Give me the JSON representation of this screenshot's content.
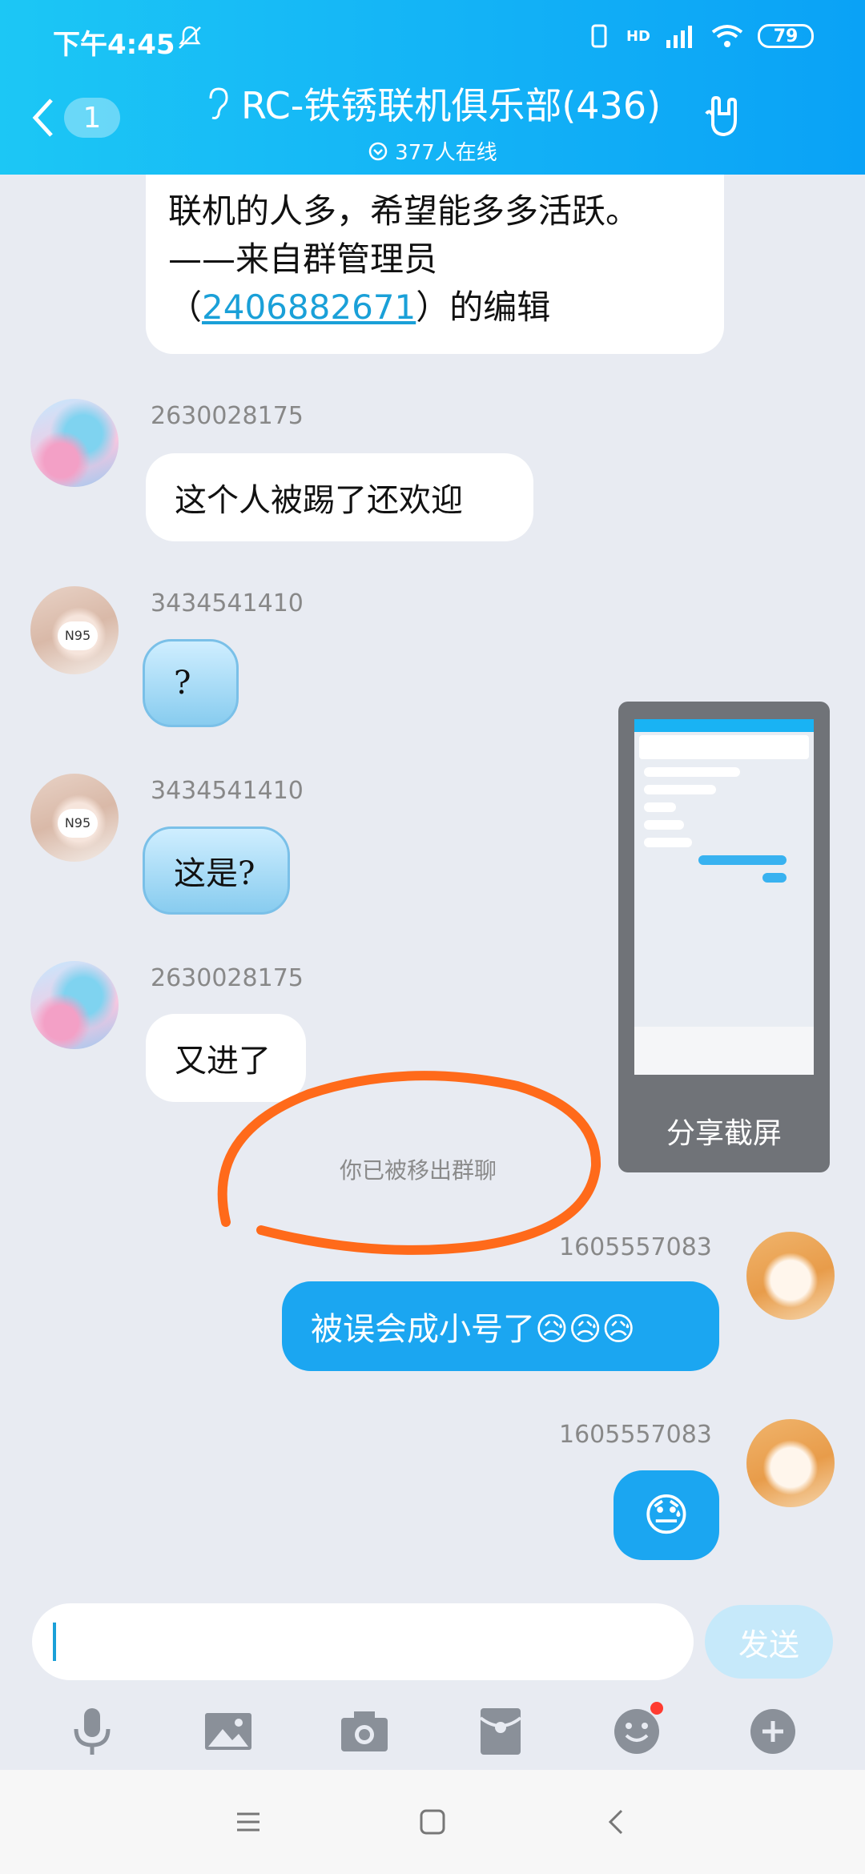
{
  "status_bar": {
    "time": "下午4:45",
    "network": "HD",
    "battery": "79"
  },
  "header": {
    "back_badge": "1",
    "title": "RC-铁锈联机俱乐部(436)",
    "subtitle": "377人在线"
  },
  "messages": {
    "top_text_line1": "联机的人多，希望能多多活跃。",
    "top_text_line2": "——来自群管理员",
    "top_text_open": "（",
    "top_text_link": "2406882671",
    "top_text_close": "）的编辑",
    "m1_sender": "2630028175",
    "m1_text": "这个人被踢了还欢迎",
    "m2_sender": "3434541410",
    "m2_text": "?",
    "m3_sender": "3434541410",
    "m3_text": "这是?",
    "m4_sender": "2630028175",
    "m4_text": "又进了",
    "system_text": "你已被移出群聊",
    "m5_sender": "1605557083",
    "m5_text": "被误会成小号了😥😥😥",
    "m6_sender": "1605557083",
    "m6_text": "😓",
    "avatar_mark": "N95"
  },
  "preview": {
    "label": "分享截屏"
  },
  "input": {
    "placeholder": "",
    "send_label": "发送"
  },
  "toolbar": [
    "microphone-icon",
    "image-icon",
    "camera-icon",
    "red-packet-icon",
    "emoji-icon",
    "plus-icon"
  ],
  "colors": {
    "header_start": "#1cc7f5",
    "header_end": "#0aa2f6",
    "self_bubble": "#1ba6f1",
    "annotation": "#ff6a1a"
  }
}
